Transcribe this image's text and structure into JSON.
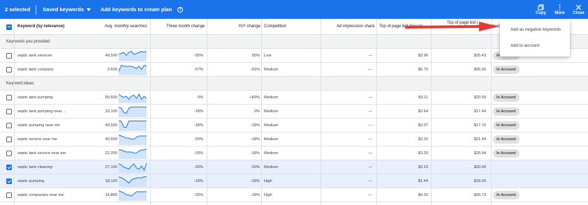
{
  "topbar": {
    "selected_count": "2 selected",
    "saved_keywords_label": "Saved keywords",
    "add_to_plan_label": "Add keywords to create plan",
    "help_glyph": "?",
    "copy_label": "Copy",
    "more_label": "More",
    "close_label": "Close"
  },
  "columns": {
    "keyword": "Keyword (by relevance)",
    "avg_searches": "Avg. monthly searches",
    "three_month": "Three month change",
    "yoy": "YoY change",
    "competition": "Competition",
    "ad_impression": "Ad impression share",
    "top_bid_low": "Top of page bid (low rai",
    "top_bid_high": "Top of page bid (",
    "account_status": "Accou"
  },
  "sections": {
    "provided": "Keywords you provided",
    "ideas": "Keyword ideas"
  },
  "badge_label": "In Account",
  "rows_provided": [
    {
      "keyword": "septic tank services",
      "searches": "40,500",
      "three_month": "-55%",
      "yoy": "55%",
      "competition": "Low",
      "ad_impression": "—",
      "bid_low": "$3.96",
      "bid_high": "$25.43",
      "in_account": true,
      "selected": false,
      "trend": [
        6,
        7,
        8,
        5,
        8,
        9,
        6,
        7,
        8,
        9,
        8,
        9
      ]
    },
    {
      "keyword": "septic tank company",
      "searches": "3,600",
      "three_month": "-57%",
      "yoy": "-91%",
      "competition": "Medium",
      "ad_impression": "—",
      "bid_low": "$5.70",
      "bid_high": "$35.00",
      "in_account": true,
      "selected": false,
      "trend": [
        3,
        9,
        8,
        8,
        8,
        8,
        7,
        6,
        8,
        5,
        9,
        8
      ]
    }
  ],
  "rows_ideas": [
    {
      "keyword": "septic tank pumping",
      "searches": "90,500",
      "three_month": "0%",
      "yoy": "+83%",
      "competition": "Medium",
      "ad_impression": "—",
      "bid_low": "$3.11",
      "bid_high": "$20.59",
      "in_account": true,
      "selected": false,
      "trend": [
        8,
        6,
        5,
        6,
        3,
        6,
        7,
        4,
        8,
        3,
        6,
        4
      ]
    },
    {
      "keyword": "septic tank pumping near ...",
      "searches": "33,100",
      "three_month": "-18%",
      "yoy": "0%",
      "competition": "Medium",
      "ad_impression": "—",
      "bid_low": "$2.64",
      "bid_high": "$17.44",
      "in_account": true,
      "selected": false,
      "trend": [
        9,
        8,
        4,
        3,
        8,
        9,
        9,
        9,
        9,
        9,
        9,
        9
      ]
    },
    {
      "keyword": "septic pumping near me",
      "searches": "49,500",
      "three_month": "-18%",
      "yoy": "-18%",
      "competition": "Medium",
      "ad_impression": "—",
      "bid_low": "$3.07",
      "bid_high": "$17.70",
      "in_account": true,
      "selected": false,
      "trend": [
        9,
        9,
        3,
        3,
        9,
        9,
        9,
        9,
        9,
        9,
        9,
        9
      ]
    },
    {
      "keyword": "septic service near me",
      "searches": "40,500",
      "three_month": "-33%",
      "yoy": "-18%",
      "competition": "Medium",
      "ad_impression": "—",
      "bid_low": "$3.31",
      "bid_high": "$21.44",
      "in_account": true,
      "selected": false,
      "trend": [
        9,
        8,
        7,
        6,
        6,
        5,
        5,
        7,
        8,
        8,
        8,
        8
      ]
    },
    {
      "keyword": "septic tank service near me",
      "searches": "22,200",
      "three_month": "-33%",
      "yoy": "-18%",
      "competition": "Medium",
      "ad_impression": "—",
      "bid_low": "$3.20",
      "bid_high": "$25.94",
      "in_account": true,
      "selected": false,
      "trend": [
        8,
        8,
        7,
        6,
        6,
        6,
        5,
        5,
        7,
        8,
        8,
        9
      ]
    },
    {
      "keyword": "septic tank cleaning",
      "searches": "27,100",
      "three_month": "-33%",
      "yoy": "-33%",
      "competition": "Medium",
      "ad_impression": "—",
      "bid_low": "$2.23",
      "bid_high": "$20.00",
      "in_account": false,
      "selected": true,
      "trend": [
        8,
        7,
        5,
        4,
        3,
        6,
        8,
        4,
        3,
        6,
        2,
        9
      ]
    },
    {
      "keyword": "septic pumping",
      "searches": "18,100",
      "three_month": "-18%",
      "yoy": "-18%",
      "competition": "High",
      "ad_impression": "—",
      "bid_low": "$1.44",
      "bid_high": "$18.00",
      "in_account": false,
      "selected": true,
      "trend": [
        9,
        8,
        7,
        5,
        3,
        6,
        7,
        8,
        8,
        8,
        9,
        9
      ]
    },
    {
      "keyword": "septic companies near me",
      "searches": "14,800",
      "three_month": "-33%",
      "yoy": "-18%",
      "competition": "High",
      "ad_impression": "—",
      "bid_low": "$4.31",
      "bid_high": "$26.73",
      "in_account": true,
      "selected": false,
      "trend": [
        9,
        8,
        7,
        5,
        5,
        4,
        6,
        8,
        8,
        8,
        8,
        8
      ]
    }
  ],
  "menu": {
    "item1": "Add as negative keywords",
    "item2": "Add to account"
  },
  "colors": {
    "accent": "#1a73e8",
    "arrow": "#e53935",
    "selected_row": "#e8f0fe"
  }
}
